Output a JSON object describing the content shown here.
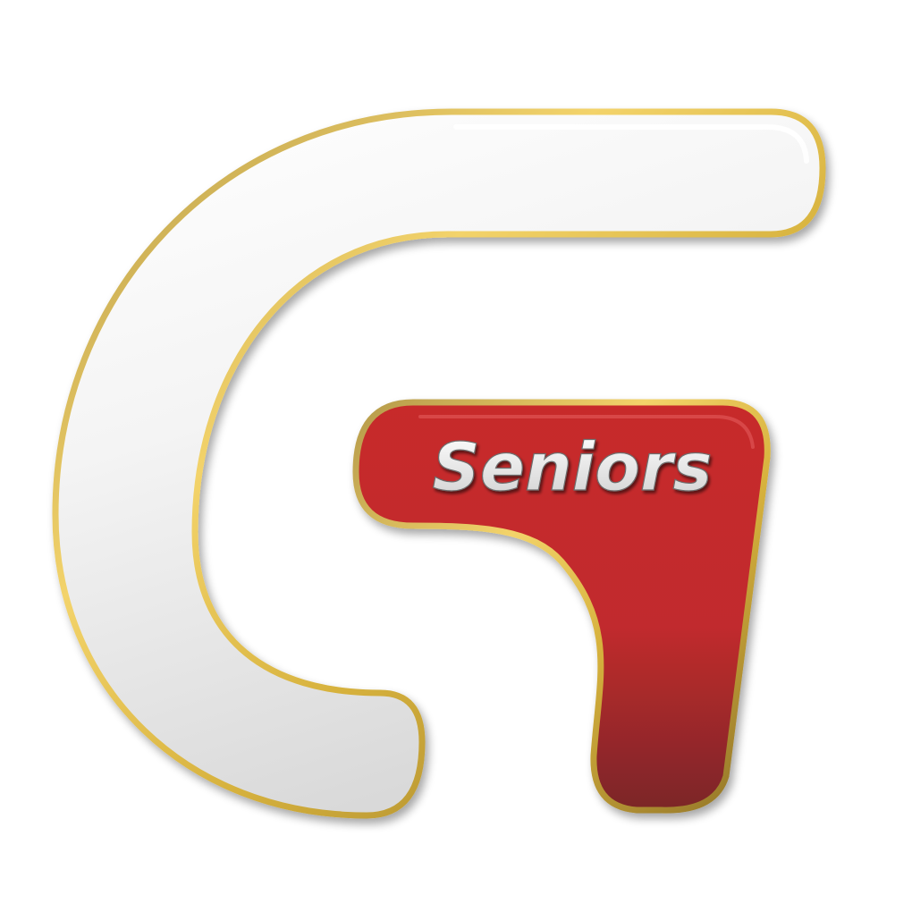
{
  "logo": {
    "wordmark": "Seniors",
    "colors": {
      "background": "#ffffff",
      "white_body_light": "#ffffff",
      "white_body_shade": "#d9d9d9",
      "gold_rim_light": "#f3d36a",
      "gold_rim_dark": "#8f7228",
      "red_top": "#c72a2c",
      "red_bottom": "#7b2628",
      "wordmark_fill": "#f2f2f2"
    }
  }
}
